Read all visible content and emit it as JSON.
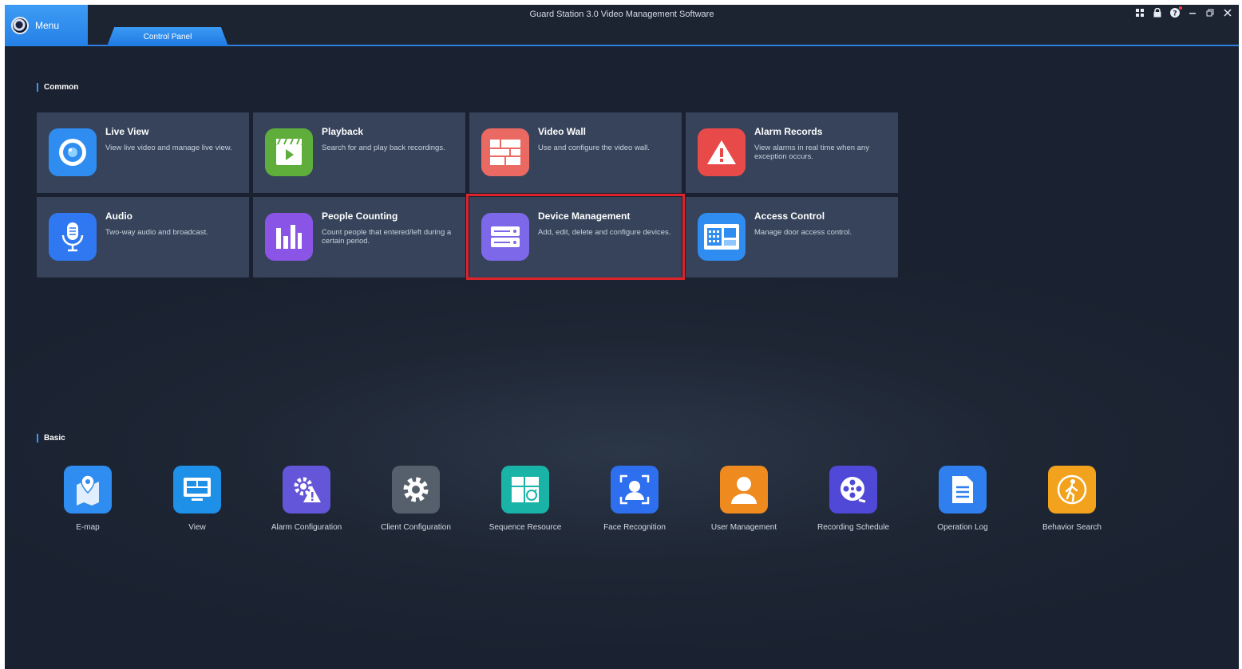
{
  "window": {
    "title": "Guard Station 3.0 Video Management Software"
  },
  "menu": {
    "label": "Menu"
  },
  "tabs": [
    {
      "label": "Control Panel"
    }
  ],
  "common": {
    "title": "Common",
    "cards": [
      {
        "title": "Live View",
        "desc": "View live video and manage live view.",
        "icon": "camera-icon",
        "color": "#2f8cf0"
      },
      {
        "title": "Playback",
        "desc": "Search for and play back recordings.",
        "icon": "clapperboard-icon",
        "color": "#5fae3b"
      },
      {
        "title": "Video Wall",
        "desc": "Use and configure the video wall.",
        "icon": "video-wall-icon",
        "color": "#ea6a63"
      },
      {
        "title": "Alarm Records",
        "desc": "View alarms in real time when any exception occurs.",
        "icon": "alarm-warning-icon",
        "color": "#e84a4a"
      },
      {
        "title": "Audio",
        "desc": "Two-way audio and broadcast.",
        "icon": "microphone-icon",
        "color": "#2f78f2"
      },
      {
        "title": "People Counting",
        "desc": "Count people that entered/left during a certain period.",
        "icon": "bar-chart-icon",
        "color": "#8a55e6"
      },
      {
        "title": "Device Management",
        "desc": "Add, edit, delete and configure devices.",
        "icon": "device-icon",
        "color": "#7d68ea"
      },
      {
        "title": "Access Control",
        "desc": "Manage door access control.",
        "icon": "access-panel-icon",
        "color": "#2f8cf0"
      }
    ]
  },
  "basic": {
    "title": "Basic",
    "items": [
      {
        "label": "E-map",
        "icon": "map-pin-icon",
        "color": "#2f8cf0"
      },
      {
        "label": "View",
        "icon": "view-layout-icon",
        "color": "#1e90e8"
      },
      {
        "label": "Alarm Configuration",
        "icon": "alarm-config-icon",
        "color": "#6456d8"
      },
      {
        "label": "Client Configuration",
        "icon": "gear-icon",
        "color": "#56606c"
      },
      {
        "label": "Sequence Resource",
        "icon": "sequence-icon",
        "color": "#19b3a8"
      },
      {
        "label": "Face Recognition",
        "icon": "face-scan-icon",
        "color": "#2e6ff0"
      },
      {
        "label": "User Management",
        "icon": "user-icon",
        "color": "#ee8a1e"
      },
      {
        "label": "Recording Schedule",
        "icon": "film-reel-icon",
        "color": "#5048d6"
      },
      {
        "label": "Operation Log",
        "icon": "document-icon",
        "color": "#2f80ee"
      },
      {
        "label": "Behavior Search",
        "icon": "walking-person-icon",
        "color": "#f2a21c"
      }
    ]
  }
}
